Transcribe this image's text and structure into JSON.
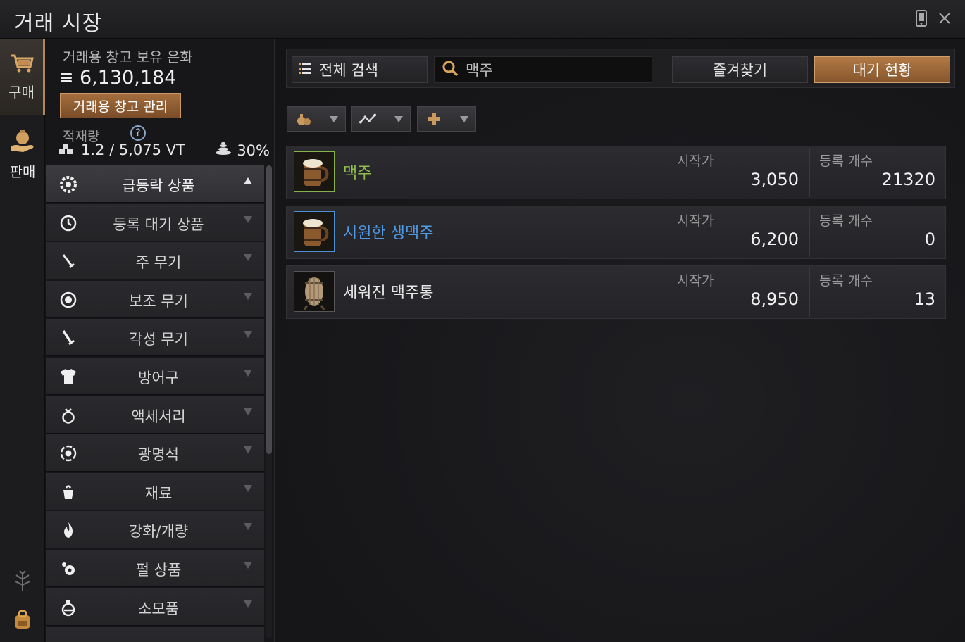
{
  "window": {
    "title": "거래 시장"
  },
  "rail": {
    "buy_label": "구매",
    "sell_label": "판매"
  },
  "left": {
    "silver_label": "거래용 창고 보유 은화",
    "silver_amount": "6,130,184",
    "warehouse_button": "거래용 창고 관리",
    "weight_label": "적재량",
    "help": "?",
    "weight_value": "1.2 / 5,075 VT",
    "weight_percent": "30%",
    "categories": [
      {
        "label": "급등락 상품",
        "icon": "flower-gear-icon"
      },
      {
        "label": "등록 대기 상품",
        "icon": "clock-icon"
      },
      {
        "label": "주 무기",
        "icon": "sword-icon"
      },
      {
        "label": "보조 무기",
        "icon": "shield-icon"
      },
      {
        "label": "각성 무기",
        "icon": "sword-icon"
      },
      {
        "label": "방어구",
        "icon": "armor-icon"
      },
      {
        "label": "액세서리",
        "icon": "ring-icon"
      },
      {
        "label": "광명석",
        "icon": "crystal-icon"
      },
      {
        "label": "재료",
        "icon": "material-icon"
      },
      {
        "label": "강화/개량",
        "icon": "flame-icon"
      },
      {
        "label": "펄 상품",
        "icon": "pearl-icon"
      },
      {
        "label": "소모품",
        "icon": "potion-icon"
      }
    ]
  },
  "search": {
    "all_search": "전체 검색",
    "query": "맥주",
    "favorites": "즐겨찾기",
    "waiting_status": "대기 현황"
  },
  "filters": [
    {
      "icon": "bag-icon"
    },
    {
      "icon": "trend-icon"
    },
    {
      "icon": "plus-icon"
    }
  ],
  "items": [
    {
      "name": "맥주",
      "name_color": "#8fbf4a",
      "frame": "green",
      "price_label": "시작가",
      "price": "3,050",
      "count_label": "등록 개수",
      "count": "21320",
      "icon": "beer-mug-icon"
    },
    {
      "name": "시원한 생맥주",
      "name_color": "#4d9be6",
      "frame": "blue",
      "price_label": "시작가",
      "price": "6,200",
      "count_label": "등록 개수",
      "count": "0",
      "icon": "beer-mug-icon"
    },
    {
      "name": "세워진 맥주통",
      "name_color": "#e6e6e6",
      "frame": "plain",
      "price_label": "시작가",
      "price": "8,950",
      "count_label": "등록 개수",
      "count": "13",
      "icon": "barrel-icon"
    }
  ]
}
